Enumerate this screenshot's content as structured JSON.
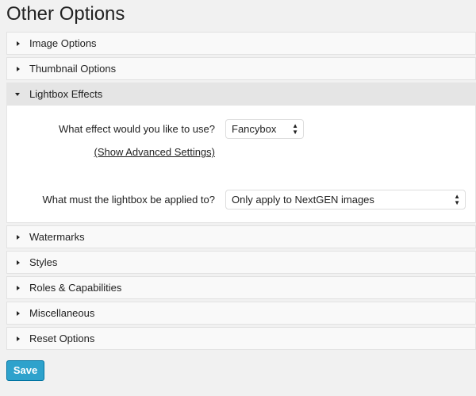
{
  "title": "Other Options",
  "sections": [
    "Image Options",
    "Thumbnail Options",
    "Lightbox Effects",
    "Watermarks",
    "Styles",
    "Roles & Capabilities",
    "Miscellaneous",
    "Reset Options"
  ],
  "lightbox": {
    "effect_question": "What effect would you like to use?",
    "effect_value": "Fancybox",
    "advanced_link": "(Show Advanced Settings)",
    "apply_question": "What must the lightbox be applied to?",
    "apply_value": "Only apply to NextGEN images"
  },
  "save_label": "Save"
}
